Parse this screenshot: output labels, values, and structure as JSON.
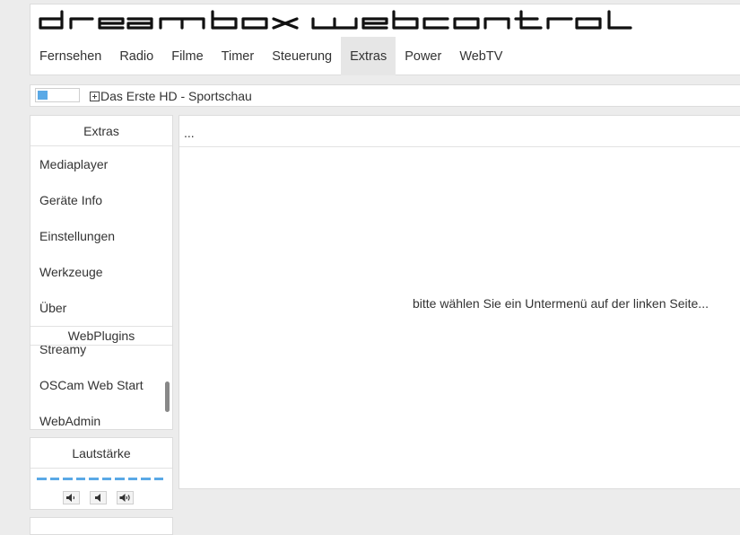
{
  "header": {
    "logo_alt": "dreambox webcontrol",
    "nav": [
      {
        "label": "Fernsehen",
        "active": false
      },
      {
        "label": "Radio",
        "active": false
      },
      {
        "label": "Filme",
        "active": false
      },
      {
        "label": "Timer",
        "active": false
      },
      {
        "label": "Steuerung",
        "active": false
      },
      {
        "label": "Extras",
        "active": true
      },
      {
        "label": "Power",
        "active": false
      },
      {
        "label": "WebTV",
        "active": false
      }
    ]
  },
  "status": {
    "signal_level": 0.25,
    "current_channel": "Das Erste HD - Sportschau"
  },
  "sidebar": {
    "extras": {
      "title": "Extras",
      "items": [
        "Mediaplayer",
        "Geräte Info",
        "Einstellungen",
        "Werkzeuge",
        "Über"
      ]
    },
    "webplugins": {
      "title": "WebPlugins",
      "items": [
        "Streamy",
        "OSCam Web Start",
        "WebAdmin"
      ]
    },
    "volume": {
      "title": "Lautstärke",
      "level_steps": 10,
      "level_max": 10
    }
  },
  "main": {
    "header": "...",
    "message": "bitte wählen Sie ein Untermenü auf der linken Seite..."
  },
  "colors": {
    "accent": "#5aa9e6",
    "background": "#ececec",
    "panel": "#ffffff",
    "active_tab": "#e6e6e6"
  }
}
